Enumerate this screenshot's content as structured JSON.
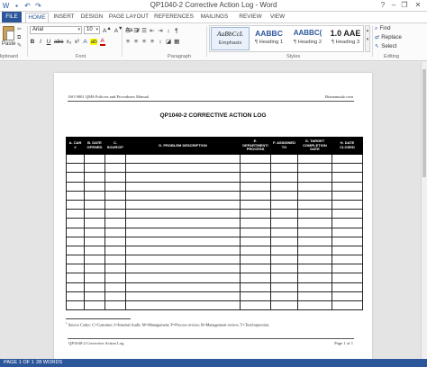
{
  "window": {
    "title": "QP1040-2 Corrective Action Log - Word",
    "help": "?",
    "minimize": "–",
    "restore": "❐",
    "close": "✕"
  },
  "tabs": [
    "FILE",
    "HOME",
    "INSERT",
    "DESIGN",
    "PAGE LAYOUT",
    "REFERENCES",
    "MAILINGS",
    "REVIEW",
    "VIEW"
  ],
  "active_tab": "HOME",
  "ribbon": {
    "clipboard": {
      "paste": "Paste",
      "label": "lipboard"
    },
    "font": {
      "name": "Arial",
      "size": "10",
      "row2": [
        "B",
        "I",
        "U",
        "abc",
        "x₂",
        "x²",
        "A",
        "ab",
        "A"
      ],
      "label": "Font"
    },
    "paragraph": {
      "row1": [
        "☰",
        "☰",
        "☰",
        "⇤",
        "⇥",
        "↕",
        "¶"
      ],
      "row2": [
        "≡",
        "≡",
        "≡",
        "≡",
        "↕",
        "◪",
        "▦"
      ],
      "label": "Paragraph"
    },
    "styles": {
      "items": [
        {
          "sample": "AaBbCcL",
          "name": "Emphasis"
        },
        {
          "sample": "AABBC",
          "name": "¶ Heading 1"
        },
        {
          "sample": "AABBC(",
          "name": "¶ Heading 2"
        },
        {
          "sample": "1.0 AAE",
          "name": "¶ Heading 3"
        }
      ],
      "label": "Styles"
    },
    "editing": {
      "find": "Find",
      "replace": "Replace",
      "select": "Select",
      "label": "Editing"
    }
  },
  "document": {
    "header_left": "ISO 9001 QMS Policies and Procedures Manual",
    "header_right": "Bizmanualz.com",
    "title": "QP1040-2 CORRECTIVE ACTION LOG",
    "columns": [
      "A. CAR #",
      "B. DATE OPENED",
      "C. SOURCE¹",
      "D. PROBLEM DESCRIPTION",
      "E. DEPARTMENT/ PROCESS",
      "F. ASSIGNED TO",
      "G. TARGET COMPLETION DATE",
      "H. DATE CLOSED"
    ],
    "empty_rows": 17,
    "footnote": "Source Codes: C=Customer; I=Internal Audit; M=Management; P=Process review; R=Management review; T=Test/inspection.",
    "footnote_mark": "1",
    "footer_left": "QP1040-2 Corrective Action Log",
    "footer_right": "Page 1 of 1"
  },
  "status": {
    "page": "PAGE 1 OF 1",
    "words": "28 WORDS"
  }
}
